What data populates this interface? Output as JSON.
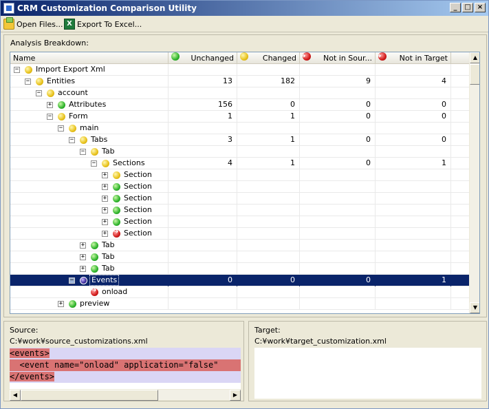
{
  "window": {
    "title": "CRM Customization Comparison Utility"
  },
  "toolbar": {
    "open_label": "Open Files...",
    "export_label": "Export To Excel..."
  },
  "group_label": "Analysis Breakdown:",
  "columns": [
    {
      "label": "Name",
      "icon": null
    },
    {
      "label": "Unchanged",
      "icon": "green-dot-icon"
    },
    {
      "label": "Changed",
      "icon": "yellow-dot-icon"
    },
    {
      "label": "Not in Sour...",
      "icon": "red-arrow-icon"
    },
    {
      "label": "Not in Target",
      "icon": "red-arrow-icon"
    }
  ],
  "rows": [
    {
      "depth": 0,
      "toggle": "minus",
      "dot": "yellow",
      "label": "Import Export Xml",
      "values": [
        "",
        "",
        "",
        ""
      ]
    },
    {
      "depth": 1,
      "toggle": "minus",
      "dot": "yellow",
      "label": "Entities",
      "values": [
        "13",
        "182",
        "9",
        "4"
      ]
    },
    {
      "depth": 2,
      "toggle": "minus",
      "dot": "yellow",
      "label": "account",
      "values": [
        "",
        "",
        "",
        ""
      ]
    },
    {
      "depth": 3,
      "toggle": "plus",
      "dot": "green",
      "label": "Attributes",
      "values": [
        "156",
        "0",
        "0",
        "0"
      ]
    },
    {
      "depth": 3,
      "toggle": "minus",
      "dot": "yellow",
      "label": "Form",
      "values": [
        "1",
        "1",
        "0",
        "0"
      ]
    },
    {
      "depth": 4,
      "toggle": "minus",
      "dot": "yellow",
      "label": "main",
      "values": [
        "",
        "",
        "",
        ""
      ]
    },
    {
      "depth": 5,
      "toggle": "minus",
      "dot": "yellow",
      "label": "Tabs",
      "values": [
        "3",
        "1",
        "0",
        "0"
      ]
    },
    {
      "depth": 6,
      "toggle": "minus",
      "dot": "yellow",
      "label": "Tab",
      "values": [
        "",
        "",
        "",
        ""
      ]
    },
    {
      "depth": 7,
      "toggle": "minus",
      "dot": "yellow",
      "label": "Sections",
      "values": [
        "4",
        "1",
        "0",
        "1"
      ]
    },
    {
      "depth": 8,
      "toggle": "plus",
      "dot": "yellow",
      "label": "Section",
      "values": [
        "",
        "",
        "",
        ""
      ]
    },
    {
      "depth": 8,
      "toggle": "plus",
      "dot": "green",
      "label": "Section",
      "values": [
        "",
        "",
        "",
        ""
      ]
    },
    {
      "depth": 8,
      "toggle": "plus",
      "dot": "green",
      "label": "Section",
      "values": [
        "",
        "",
        "",
        ""
      ]
    },
    {
      "depth": 8,
      "toggle": "plus",
      "dot": "green",
      "label": "Section",
      "values": [
        "",
        "",
        "",
        ""
      ]
    },
    {
      "depth": 8,
      "toggle": "plus",
      "dot": "green",
      "label": "Section",
      "values": [
        "",
        "",
        "",
        ""
      ]
    },
    {
      "depth": 8,
      "toggle": "plus",
      "dot": "red",
      "label": "Section",
      "values": [
        "",
        "",
        "",
        ""
      ]
    },
    {
      "depth": 6,
      "toggle": "plus",
      "dot": "green",
      "label": "Tab",
      "values": [
        "",
        "",
        "",
        ""
      ]
    },
    {
      "depth": 6,
      "toggle": "plus",
      "dot": "green",
      "label": "Tab",
      "values": [
        "",
        "",
        "",
        ""
      ]
    },
    {
      "depth": 6,
      "toggle": "plus",
      "dot": "green",
      "label": "Tab",
      "values": [
        "",
        "",
        "",
        ""
      ]
    },
    {
      "depth": 5,
      "toggle": "minus",
      "dot": "purple",
      "label": "Events",
      "values": [
        "0",
        "0",
        "0",
        "1"
      ],
      "selected": true
    },
    {
      "depth": 6,
      "toggle": "none",
      "dot": "red",
      "label": "onload",
      "values": [
        "",
        "",
        "",
        ""
      ]
    },
    {
      "depth": 4,
      "toggle": "plus",
      "dot": "green",
      "label": "preview",
      "values": [
        "",
        "",
        "",
        ""
      ]
    }
  ],
  "source": {
    "label": "Source:",
    "path": "C:¥work¥source_customizations.xml",
    "lines": [
      "<events>",
      "  <event name=\"onload\" application=\"false\"",
      "</events>"
    ]
  },
  "target": {
    "label": "Target:",
    "path": "C:¥work¥target_customization.xml"
  }
}
